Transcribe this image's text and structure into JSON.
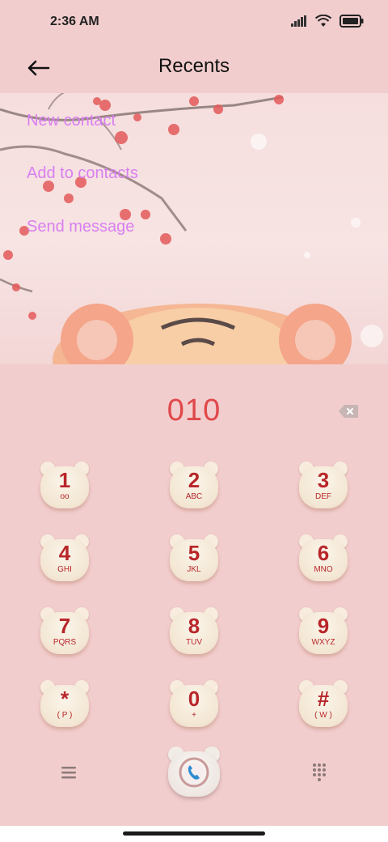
{
  "status_bar": {
    "time": "2:36 AM"
  },
  "header": {
    "title": "Recents"
  },
  "menu": {
    "items": [
      {
        "label": "New contact"
      },
      {
        "label": "Add to contacts"
      },
      {
        "label": "Send message"
      }
    ]
  },
  "dialer": {
    "number": "010"
  },
  "keypad": [
    {
      "digit": "1",
      "letters": "oo"
    },
    {
      "digit": "2",
      "letters": "ABC"
    },
    {
      "digit": "3",
      "letters": "DEF"
    },
    {
      "digit": "4",
      "letters": "GHI"
    },
    {
      "digit": "5",
      "letters": "JKL"
    },
    {
      "digit": "6",
      "letters": "MNO"
    },
    {
      "digit": "7",
      "letters": "PQRS"
    },
    {
      "digit": "8",
      "letters": "TUV"
    },
    {
      "digit": "9",
      "letters": "WXYZ"
    },
    {
      "digit": "*",
      "letters": "( P )"
    },
    {
      "digit": "0",
      "letters": "+"
    },
    {
      "digit": "#",
      "letters": "( W )"
    }
  ],
  "colors": {
    "background": "#f2cdcd",
    "menu_link": "#d97ff0",
    "number": "#e0484a",
    "key_text": "#b8262a"
  },
  "icons": {
    "back": "arrow-left-icon",
    "backspace": "backspace-icon",
    "menu": "hamburger-icon",
    "call": "phone-icon",
    "dialpad": "dialpad-icon"
  }
}
